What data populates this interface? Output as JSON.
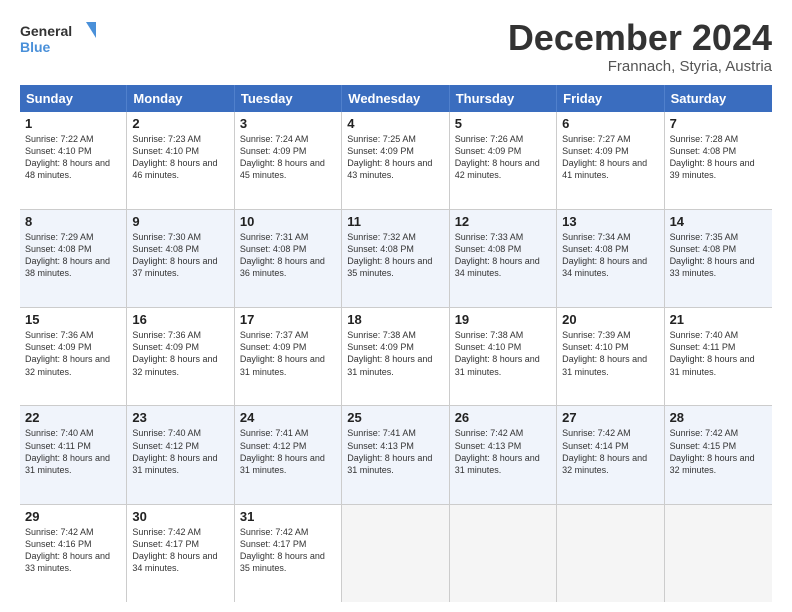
{
  "logo": {
    "line1": "General",
    "line2": "Blue"
  },
  "title": "December 2024",
  "location": "Frannach, Styria, Austria",
  "days_of_week": [
    "Sunday",
    "Monday",
    "Tuesday",
    "Wednesday",
    "Thursday",
    "Friday",
    "Saturday"
  ],
  "weeks": [
    [
      {
        "day": "1",
        "sunrise": "Sunrise: 7:22 AM",
        "sunset": "Sunset: 4:10 PM",
        "daylight": "Daylight: 8 hours and 48 minutes."
      },
      {
        "day": "2",
        "sunrise": "Sunrise: 7:23 AM",
        "sunset": "Sunset: 4:10 PM",
        "daylight": "Daylight: 8 hours and 46 minutes."
      },
      {
        "day": "3",
        "sunrise": "Sunrise: 7:24 AM",
        "sunset": "Sunset: 4:09 PM",
        "daylight": "Daylight: 8 hours and 45 minutes."
      },
      {
        "day": "4",
        "sunrise": "Sunrise: 7:25 AM",
        "sunset": "Sunset: 4:09 PM",
        "daylight": "Daylight: 8 hours and 43 minutes."
      },
      {
        "day": "5",
        "sunrise": "Sunrise: 7:26 AM",
        "sunset": "Sunset: 4:09 PM",
        "daylight": "Daylight: 8 hours and 42 minutes."
      },
      {
        "day": "6",
        "sunrise": "Sunrise: 7:27 AM",
        "sunset": "Sunset: 4:09 PM",
        "daylight": "Daylight: 8 hours and 41 minutes."
      },
      {
        "day": "7",
        "sunrise": "Sunrise: 7:28 AM",
        "sunset": "Sunset: 4:08 PM",
        "daylight": "Daylight: 8 hours and 39 minutes."
      }
    ],
    [
      {
        "day": "8",
        "sunrise": "Sunrise: 7:29 AM",
        "sunset": "Sunset: 4:08 PM",
        "daylight": "Daylight: 8 hours and 38 minutes."
      },
      {
        "day": "9",
        "sunrise": "Sunrise: 7:30 AM",
        "sunset": "Sunset: 4:08 PM",
        "daylight": "Daylight: 8 hours and 37 minutes."
      },
      {
        "day": "10",
        "sunrise": "Sunrise: 7:31 AM",
        "sunset": "Sunset: 4:08 PM",
        "daylight": "Daylight: 8 hours and 36 minutes."
      },
      {
        "day": "11",
        "sunrise": "Sunrise: 7:32 AM",
        "sunset": "Sunset: 4:08 PM",
        "daylight": "Daylight: 8 hours and 35 minutes."
      },
      {
        "day": "12",
        "sunrise": "Sunrise: 7:33 AM",
        "sunset": "Sunset: 4:08 PM",
        "daylight": "Daylight: 8 hours and 34 minutes."
      },
      {
        "day": "13",
        "sunrise": "Sunrise: 7:34 AM",
        "sunset": "Sunset: 4:08 PM",
        "daylight": "Daylight: 8 hours and 34 minutes."
      },
      {
        "day": "14",
        "sunrise": "Sunrise: 7:35 AM",
        "sunset": "Sunset: 4:08 PM",
        "daylight": "Daylight: 8 hours and 33 minutes."
      }
    ],
    [
      {
        "day": "15",
        "sunrise": "Sunrise: 7:36 AM",
        "sunset": "Sunset: 4:09 PM",
        "daylight": "Daylight: 8 hours and 32 minutes."
      },
      {
        "day": "16",
        "sunrise": "Sunrise: 7:36 AM",
        "sunset": "Sunset: 4:09 PM",
        "daylight": "Daylight: 8 hours and 32 minutes."
      },
      {
        "day": "17",
        "sunrise": "Sunrise: 7:37 AM",
        "sunset": "Sunset: 4:09 PM",
        "daylight": "Daylight: 8 hours and 31 minutes."
      },
      {
        "day": "18",
        "sunrise": "Sunrise: 7:38 AM",
        "sunset": "Sunset: 4:09 PM",
        "daylight": "Daylight: 8 hours and 31 minutes."
      },
      {
        "day": "19",
        "sunrise": "Sunrise: 7:38 AM",
        "sunset": "Sunset: 4:10 PM",
        "daylight": "Daylight: 8 hours and 31 minutes."
      },
      {
        "day": "20",
        "sunrise": "Sunrise: 7:39 AM",
        "sunset": "Sunset: 4:10 PM",
        "daylight": "Daylight: 8 hours and 31 minutes."
      },
      {
        "day": "21",
        "sunrise": "Sunrise: 7:40 AM",
        "sunset": "Sunset: 4:11 PM",
        "daylight": "Daylight: 8 hours and 31 minutes."
      }
    ],
    [
      {
        "day": "22",
        "sunrise": "Sunrise: 7:40 AM",
        "sunset": "Sunset: 4:11 PM",
        "daylight": "Daylight: 8 hours and 31 minutes."
      },
      {
        "day": "23",
        "sunrise": "Sunrise: 7:40 AM",
        "sunset": "Sunset: 4:12 PM",
        "daylight": "Daylight: 8 hours and 31 minutes."
      },
      {
        "day": "24",
        "sunrise": "Sunrise: 7:41 AM",
        "sunset": "Sunset: 4:12 PM",
        "daylight": "Daylight: 8 hours and 31 minutes."
      },
      {
        "day": "25",
        "sunrise": "Sunrise: 7:41 AM",
        "sunset": "Sunset: 4:13 PM",
        "daylight": "Daylight: 8 hours and 31 minutes."
      },
      {
        "day": "26",
        "sunrise": "Sunrise: 7:42 AM",
        "sunset": "Sunset: 4:13 PM",
        "daylight": "Daylight: 8 hours and 31 minutes."
      },
      {
        "day": "27",
        "sunrise": "Sunrise: 7:42 AM",
        "sunset": "Sunset: 4:14 PM",
        "daylight": "Daylight: 8 hours and 32 minutes."
      },
      {
        "day": "28",
        "sunrise": "Sunrise: 7:42 AM",
        "sunset": "Sunset: 4:15 PM",
        "daylight": "Daylight: 8 hours and 32 minutes."
      }
    ],
    [
      {
        "day": "29",
        "sunrise": "Sunrise: 7:42 AM",
        "sunset": "Sunset: 4:16 PM",
        "daylight": "Daylight: 8 hours and 33 minutes."
      },
      {
        "day": "30",
        "sunrise": "Sunrise: 7:42 AM",
        "sunset": "Sunset: 4:17 PM",
        "daylight": "Daylight: 8 hours and 34 minutes."
      },
      {
        "day": "31",
        "sunrise": "Sunrise: 7:42 AM",
        "sunset": "Sunset: 4:17 PM",
        "daylight": "Daylight: 8 hours and 35 minutes."
      },
      null,
      null,
      null,
      null
    ]
  ]
}
